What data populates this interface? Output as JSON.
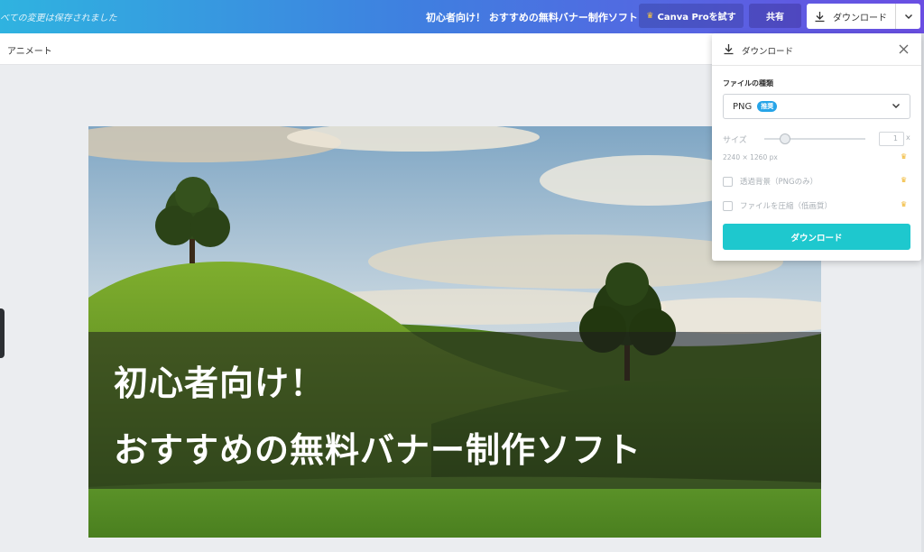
{
  "header": {
    "saved_status": "べての変更は保存されました",
    "doc_title": "初心者向け！ おすすめの無料バナー制作ソフト",
    "pro_button": "Canva Proを試す",
    "share_button": "共有",
    "download_button": "ダウンロード"
  },
  "toolbar": {
    "animate_label": "アニメート"
  },
  "design": {
    "headline_line1": "初心者向け！",
    "headline_line2": "おすすめの無料バナー制作ソフト"
  },
  "download_panel": {
    "title": "ダウンロード",
    "file_type_label": "ファイルの種類",
    "file_type_value": "PNG",
    "recommended_badge": "推奨",
    "size_label": "サイズ",
    "size_value": "1",
    "size_suffix": "x",
    "dimensions": "2240 × 1260 px",
    "transparent_bg_label": "透過背景（PNGのみ）",
    "compress_label": "ファイルを圧縮（低画質）",
    "download_button": "ダウンロード"
  },
  "colors": {
    "accent_teal": "#1ec8ce",
    "badge_blue": "#26a4e8",
    "crown_gold": "#f0b429"
  },
  "icons": [
    "crown-icon",
    "download-icon",
    "chevron-down-icon",
    "close-icon"
  ]
}
